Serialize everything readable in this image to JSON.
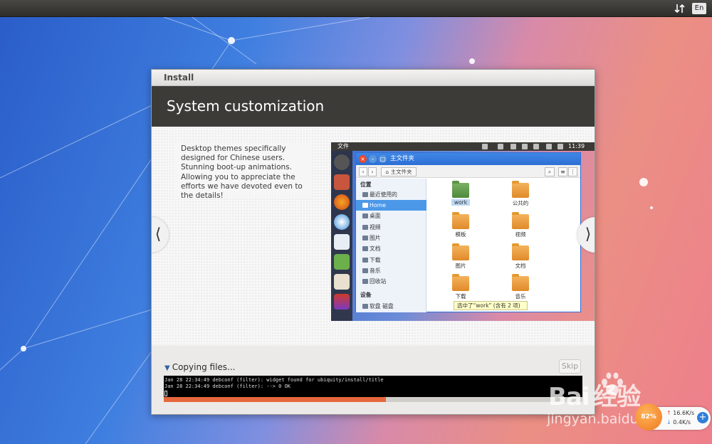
{
  "topbar": {
    "lang": "En"
  },
  "installer": {
    "window_title": "Install",
    "page_title": "System customization",
    "slide": {
      "description": "Desktop themes specifically designed for Chinese users. Stunning boot-up animations. Allowing you to appreciate the efforts we have devoted even to the details!",
      "prev_arrow": "⟨",
      "next_arrow": "⟩"
    },
    "inner_screenshot": {
      "panel_left_label": "文件",
      "clock": "11:39",
      "fm_title": "主文件夹",
      "location": "主文件夹",
      "sidebar_header": "位置",
      "sidebar_items": [
        "最近使用的",
        "Home",
        "桌面",
        "视频",
        "图片",
        "文档",
        "下载",
        "音乐",
        "回收站"
      ],
      "devices_header": "设备",
      "device_item": "软盘 磁盘",
      "folders": [
        "work",
        "公共的",
        "模板",
        "视频",
        "图片",
        "文档",
        "下载",
        "音乐"
      ],
      "status": "选中了“work” (含有 2 项)"
    },
    "progress": {
      "label": "Copying files...",
      "skip": "Skip",
      "fraction": 0.53,
      "log": [
        "Jan 28 22:34:49 debconf (filter): widget found for ubiquity/install/title",
        "Jan 28 22:34:49 debconf (filter): --> 0 OK"
      ]
    }
  },
  "speed_widget": {
    "percent": "82%",
    "upload": "16.6K/s",
    "download": "0.4K/s"
  },
  "watermark": {
    "logo": "Bai 经验",
    "url": "jingyan.baidu.com"
  },
  "colors": {
    "header": "#3d3b38",
    "progress": "#e6683c",
    "accent": "#2f7ed8"
  }
}
